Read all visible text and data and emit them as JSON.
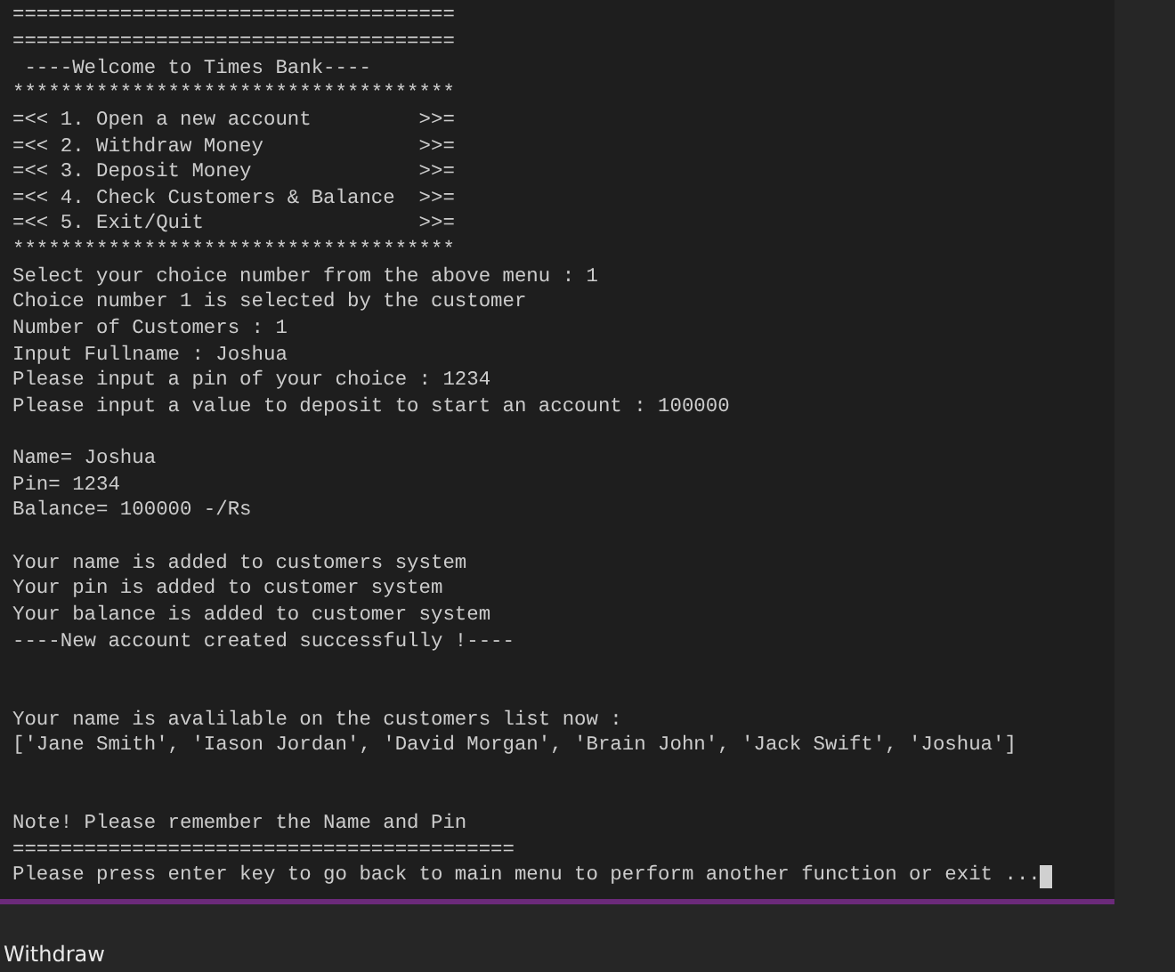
{
  "terminal": {
    "lines": [
      {
        "kind": "text",
        "text": "====================================="
      },
      {
        "kind": "text",
        "text": "====================================="
      },
      {
        "kind": "text",
        "text": " ----Welcome to Times Bank----"
      },
      {
        "kind": "text",
        "text": "*************************************"
      },
      {
        "kind": "text",
        "text": "=<< 1. Open a new account         >>="
      },
      {
        "kind": "text",
        "text": "=<< 2. Withdraw Money             >>="
      },
      {
        "kind": "text",
        "text": "=<< 3. Deposit Money              >>="
      },
      {
        "kind": "text",
        "text": "=<< 4. Check Customers & Balance  >>="
      },
      {
        "kind": "text",
        "text": "=<< 5. Exit/Quit                  >>="
      },
      {
        "kind": "text",
        "text": "*************************************"
      },
      {
        "kind": "text",
        "text": "Select your choice number from the above menu : 1"
      },
      {
        "kind": "text",
        "text": "Choice number 1 is selected by the customer"
      },
      {
        "kind": "text",
        "text": "Number of Customers : 1"
      },
      {
        "kind": "text",
        "text": "Input Fullname : Joshua"
      },
      {
        "kind": "text",
        "text": "Please input a pin of your choice : 1234"
      },
      {
        "kind": "text",
        "text": "Please input a value to deposit to start an account : 100000"
      },
      {
        "kind": "blank"
      },
      {
        "kind": "text",
        "text": "Name= Joshua"
      },
      {
        "kind": "text",
        "text": "Pin= 1234"
      },
      {
        "kind": "text",
        "text": "Balance= 100000 -/Rs"
      },
      {
        "kind": "blank"
      },
      {
        "kind": "text",
        "text": "Your name is added to customers system"
      },
      {
        "kind": "text",
        "text": "Your pin is added to customer system"
      },
      {
        "kind": "text",
        "text": "Your balance is added to customer system"
      },
      {
        "kind": "text",
        "text": "----New account created successfully !----"
      },
      {
        "kind": "blank"
      },
      {
        "kind": "blank"
      },
      {
        "kind": "text",
        "text": "Your name is avalilable on the customers list now :"
      },
      {
        "kind": "text",
        "text": "['Jane Smith', 'Iason Jordan', 'David Morgan', 'Brain John', 'Jack Swift', 'Joshua']"
      },
      {
        "kind": "blank"
      },
      {
        "kind": "blank"
      },
      {
        "kind": "text",
        "text": "Note! Please remember the Name and Pin"
      },
      {
        "kind": "text",
        "text": "=========================================="
      },
      {
        "kind": "text",
        "text": "Please press enter key to go back to main menu to perform another function or exit ...",
        "cursor": true
      }
    ]
  },
  "caption": "Withdraw"
}
